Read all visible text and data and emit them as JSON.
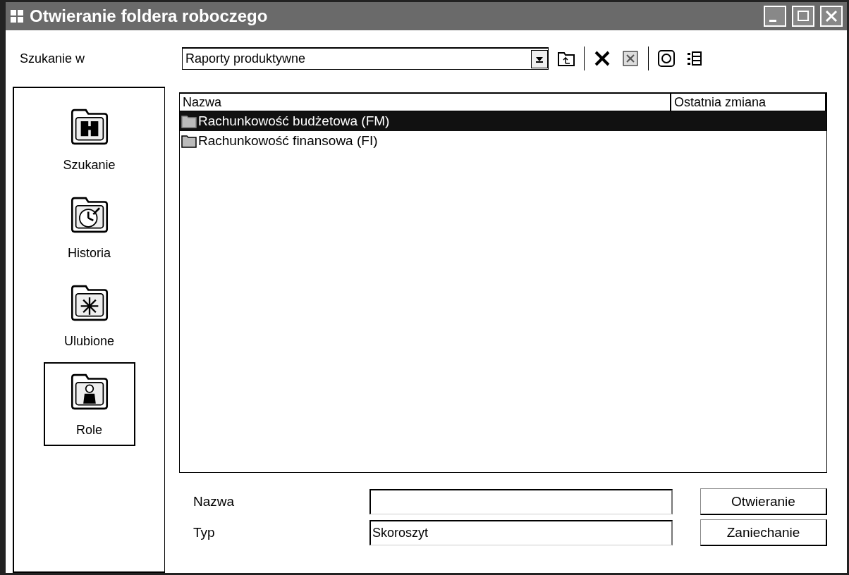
{
  "window": {
    "title": "Otwieranie foldera roboczego"
  },
  "look_in": {
    "label": "Szukanie w",
    "value": "Raporty produktywne"
  },
  "places": [
    {
      "label": "Szukanie",
      "kind": "binoculars",
      "selected": false
    },
    {
      "label": "Historia",
      "kind": "clock",
      "selected": false
    },
    {
      "label": "Ulubione",
      "kind": "star",
      "selected": false
    },
    {
      "label": "Role",
      "kind": "person",
      "selected": true
    }
  ],
  "table": {
    "columns": [
      "Nazwa",
      "Ostatnia zmiana"
    ],
    "rows": [
      {
        "name": "Rachunkowość budżetowa (FM)",
        "selected": true
      },
      {
        "name": "Rachunkowość finansowa (FI)",
        "selected": false
      }
    ]
  },
  "fields": [
    {
      "label": "Nazwa"
    },
    {
      "label": "Typ",
      "value": "Skoroszyt"
    }
  ],
  "buttons": [
    "Otwieranie",
    "Zaniechanie"
  ]
}
